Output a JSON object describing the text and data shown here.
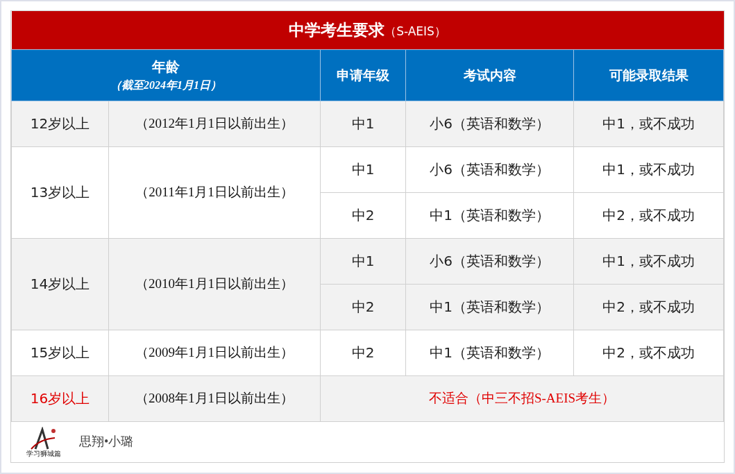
{
  "title": {
    "main": "中学考生要求",
    "suffix": "（S-AEIS）"
  },
  "header": {
    "age": "年龄",
    "age_note": "（截至2024年1月1日）",
    "grade": "申请年级",
    "exam": "考试内容",
    "result": "可能录取结果"
  },
  "groups": [
    {
      "kind": "eligible",
      "age": "12岁以上",
      "born": "（2012年1月1日以前出生）",
      "entries": [
        {
          "grade": "中1",
          "exam": "小6（英语和数学）",
          "result": "中1，或不成功"
        }
      ]
    },
    {
      "kind": "eligible",
      "age": "13岁以上",
      "born": "（2011年1月1日以前出生）",
      "entries": [
        {
          "grade": "中1",
          "exam": "小6（英语和数学）",
          "result": "中1，或不成功"
        },
        {
          "grade": "中2",
          "exam": "中1（英语和数学）",
          "result": "中2，或不成功"
        }
      ]
    },
    {
      "kind": "eligible",
      "age": "14岁以上",
      "born": "（2010年1月1日以前出生）",
      "entries": [
        {
          "grade": "中1",
          "exam": "小6（英语和数学）",
          "result": "中1，或不成功"
        },
        {
          "grade": "中2",
          "exam": "中1（英语和数学）",
          "result": "中2，或不成功"
        }
      ]
    },
    {
      "kind": "eligible",
      "age": "15岁以上",
      "born": "（2009年1月1日以前出生）",
      "entries": [
        {
          "grade": "中2",
          "exam": "中1（英语和数学）",
          "result": "中2，或不成功"
        }
      ]
    },
    {
      "kind": "ineligible",
      "age": "16岁以上",
      "born": "（2008年1月1日以前出生）",
      "note": "不适合（中三不招S-AEIS考生）"
    }
  ],
  "footer": {
    "logo_caption": "学习狮城篇",
    "author": "思翔•小璐"
  }
}
